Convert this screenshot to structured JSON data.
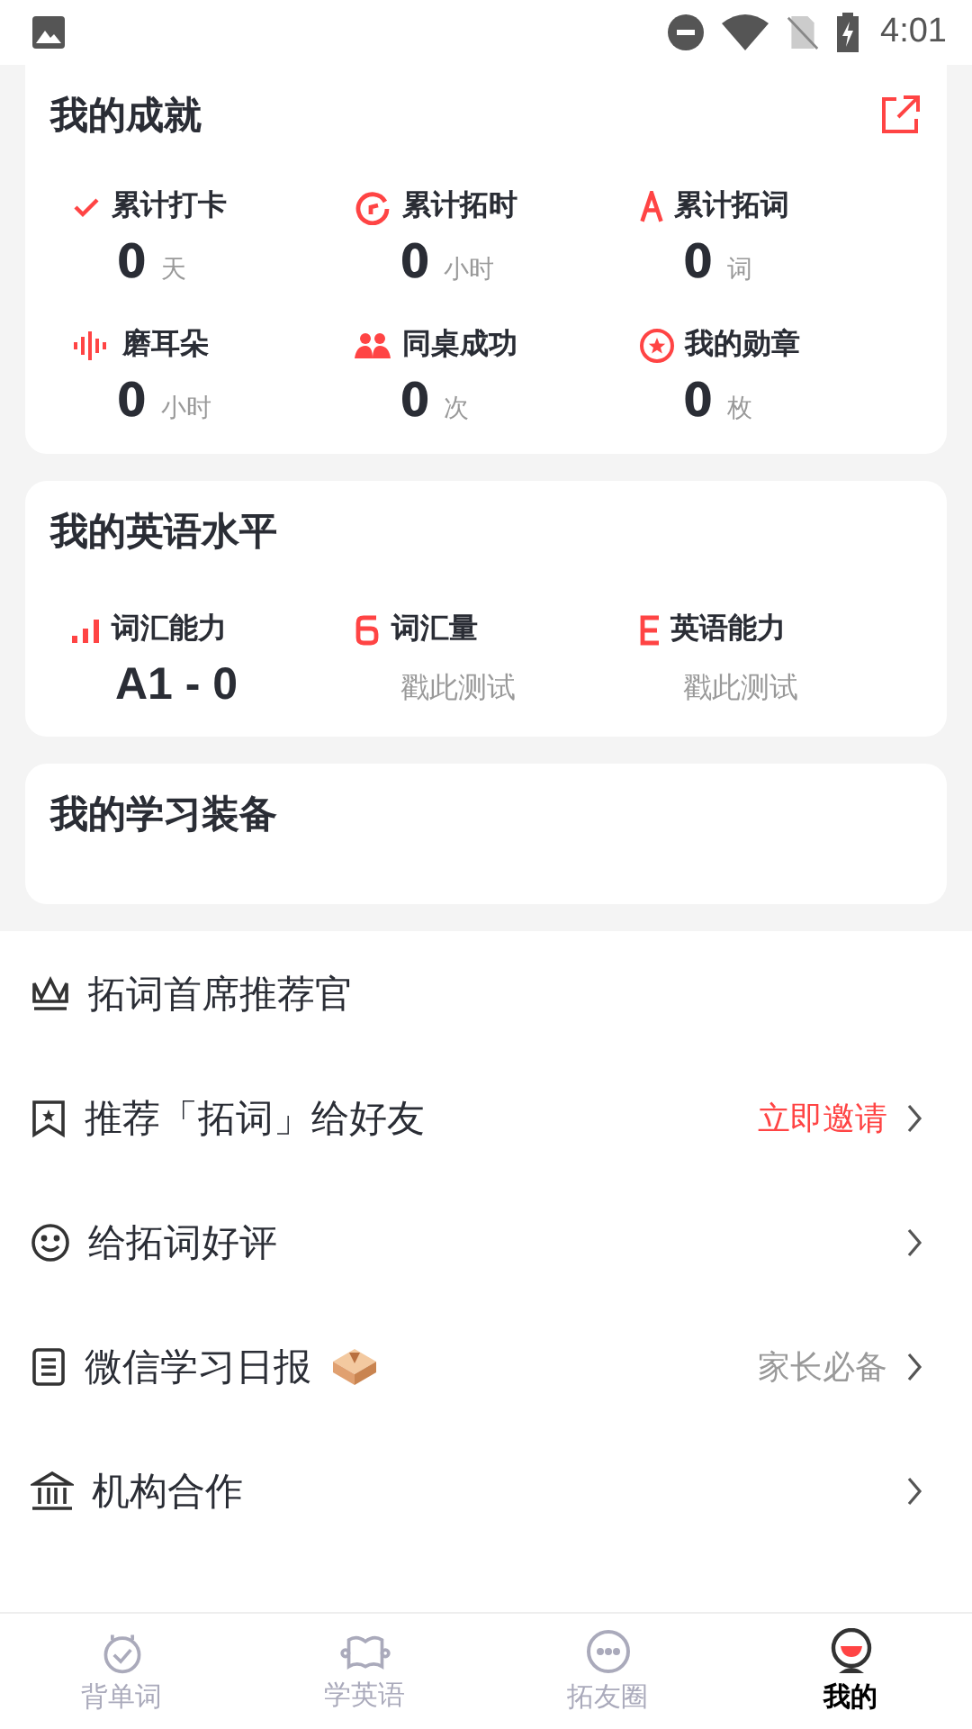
{
  "status_bar": {
    "time": "4:01"
  },
  "achievements": {
    "title": "我的成就",
    "stats": [
      {
        "kind": "check",
        "label": "累计打卡",
        "value": "0",
        "unit": "天"
      },
      {
        "kind": "clock",
        "label": "累计拓时",
        "value": "0",
        "unit": "小时"
      },
      {
        "kind": "letter",
        "label": "累计拓词",
        "value": "0",
        "unit": "词"
      },
      {
        "kind": "wave",
        "label": "磨耳朵",
        "value": "0",
        "unit": "小时"
      },
      {
        "kind": "people",
        "label": "同桌成功",
        "value": "0",
        "unit": "次"
      },
      {
        "kind": "medal",
        "label": "我的勋章",
        "value": "0",
        "unit": "枚"
      }
    ]
  },
  "english_level": {
    "title": "我的英语水平",
    "items": [
      {
        "kind": "score",
        "label": "词汇能力",
        "value": "A1 - 0"
      },
      {
        "kind": "prompt",
        "label": "词汇量",
        "value": "戳此测试"
      },
      {
        "kind": "prompt",
        "label": "英语能力",
        "value": "戳此测试"
      }
    ]
  },
  "equipment": {
    "title": "我的学习装备"
  },
  "menu": [
    {
      "kind": "crown",
      "label": "拓词首席推荐官",
      "badge": false,
      "chevron": false
    },
    {
      "kind": "bookmark",
      "label": "推荐「拓词」给好友",
      "badge": false,
      "note": "立即邀请",
      "color": "#ff4444",
      "chevron": true
    },
    {
      "kind": "smile",
      "label": "给拓词好评",
      "badge": false,
      "chevron": true
    },
    {
      "kind": "doc",
      "label": "微信学习日报",
      "badge": true,
      "note": "家长必备",
      "color": "#999999",
      "chevron": true
    },
    {
      "kind": "bank",
      "label": "机构合作",
      "badge": false,
      "chevron": true
    }
  ],
  "tabs": [
    {
      "kind": "alarm",
      "label": "背单词",
      "selected": false
    },
    {
      "kind": "book",
      "label": "学英语",
      "selected": false
    },
    {
      "kind": "chat",
      "label": "拓友圈",
      "selected": false
    },
    {
      "kind": "me",
      "label": "我的",
      "selected": true
    }
  ]
}
